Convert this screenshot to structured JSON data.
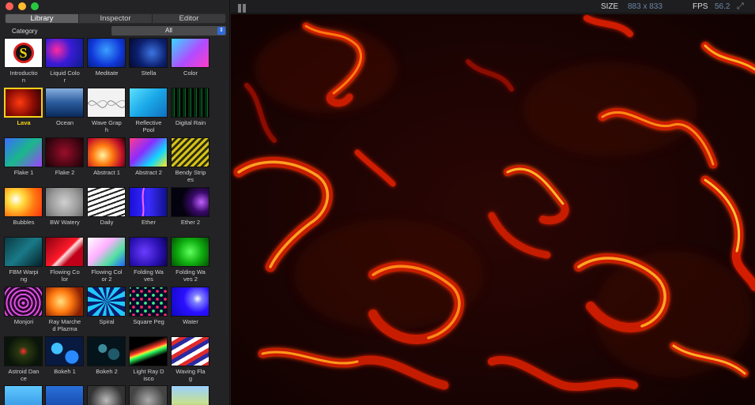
{
  "tabs": [
    "Library",
    "Inspector",
    "Editor"
  ],
  "active_tab": 0,
  "category": {
    "label": "Category",
    "value": "All"
  },
  "topbar": {
    "size_label": "SIZE",
    "size_value": "883 x 833",
    "fps_label": "FPS",
    "fps_value": "56.2"
  },
  "icons": {
    "pause": "pause-icon",
    "expand": "expand-icon",
    "select": "chevron-updown-icon"
  },
  "colors": {
    "accent": "#f5d21a",
    "select_blue": "#2f6bd8",
    "readout": "#6b86a6"
  },
  "library": [
    {
      "name": "Introduction",
      "label_lines": [
        "Introductio",
        "n"
      ]
    },
    {
      "name": "Liquid Color",
      "label_lines": [
        "Liquid Colo",
        "r"
      ]
    },
    {
      "name": "Meditate",
      "label_lines": [
        "Meditate"
      ]
    },
    {
      "name": "Stella",
      "label_lines": [
        "Stella"
      ]
    },
    {
      "name": "Color",
      "label_lines": [
        "Color"
      ]
    },
    {
      "name": "Lava",
      "label_lines": [
        "Lava"
      ],
      "selected": true
    },
    {
      "name": "Ocean",
      "label_lines": [
        "Ocean"
      ]
    },
    {
      "name": "Wave Graph",
      "label_lines": [
        "Wave Grap",
        "h"
      ]
    },
    {
      "name": "Reflective Pool",
      "label_lines": [
        "Reflective",
        "Pool"
      ]
    },
    {
      "name": "Digital Rain",
      "label_lines": [
        "Digital Rain"
      ]
    },
    {
      "name": "Flake 1",
      "label_lines": [
        "Flake 1"
      ]
    },
    {
      "name": "Flake 2",
      "label_lines": [
        "Flake 2"
      ]
    },
    {
      "name": "Abstract 1",
      "label_lines": [
        "Abstract 1"
      ]
    },
    {
      "name": "Abstract 2",
      "label_lines": [
        "Abstract 2"
      ]
    },
    {
      "name": "Bendy Stripes",
      "label_lines": [
        "Bendy Strip",
        "es"
      ]
    },
    {
      "name": "Bubbles",
      "label_lines": [
        "Bubbles"
      ]
    },
    {
      "name": "BW Watery",
      "label_lines": [
        "BW Watery"
      ]
    },
    {
      "name": "Daily",
      "label_lines": [
        "Daily"
      ]
    },
    {
      "name": "Ether",
      "label_lines": [
        "Ether"
      ]
    },
    {
      "name": "Ether 2",
      "label_lines": [
        "Ether 2"
      ]
    },
    {
      "name": "FBM Warping",
      "label_lines": [
        "FBM Warpi",
        "ng"
      ]
    },
    {
      "name": "Flowing Color",
      "label_lines": [
        "Flowing Co",
        "lor"
      ]
    },
    {
      "name": "Flowing Color 2",
      "label_lines": [
        "Flowing Col",
        "or 2"
      ]
    },
    {
      "name": "Folding Waves",
      "label_lines": [
        "Folding Wa",
        "ves"
      ]
    },
    {
      "name": "Folding Waves 2",
      "label_lines": [
        "Folding Wa",
        "ves 2"
      ]
    },
    {
      "name": "Monjori",
      "label_lines": [
        "Monjori"
      ]
    },
    {
      "name": "Ray Marched Plazma",
      "label_lines": [
        "Ray Marche",
        "d Plazma"
      ]
    },
    {
      "name": "Spiral",
      "label_lines": [
        "Spiral"
      ]
    },
    {
      "name": "Square Peg",
      "label_lines": [
        "Square Peg"
      ]
    },
    {
      "name": "Water",
      "label_lines": [
        "Water"
      ]
    },
    {
      "name": "Astroid Dance",
      "label_lines": [
        "Astroid Dan",
        "ce"
      ]
    },
    {
      "name": "Bokeh 1",
      "label_lines": [
        "Bokeh 1"
      ]
    },
    {
      "name": "Bokeh 2",
      "label_lines": [
        "Bokeh 2"
      ]
    },
    {
      "name": "Light Ray Disco",
      "label_lines": [
        "Light Ray D",
        "isco"
      ]
    },
    {
      "name": "Waving Flag",
      "label_lines": [
        "Waving Fla",
        "g"
      ]
    },
    {
      "name": "",
      "label_lines": []
    },
    {
      "name": "",
      "label_lines": []
    },
    {
      "name": "",
      "label_lines": []
    },
    {
      "name": "",
      "label_lines": []
    },
    {
      "name": "",
      "label_lines": []
    }
  ]
}
